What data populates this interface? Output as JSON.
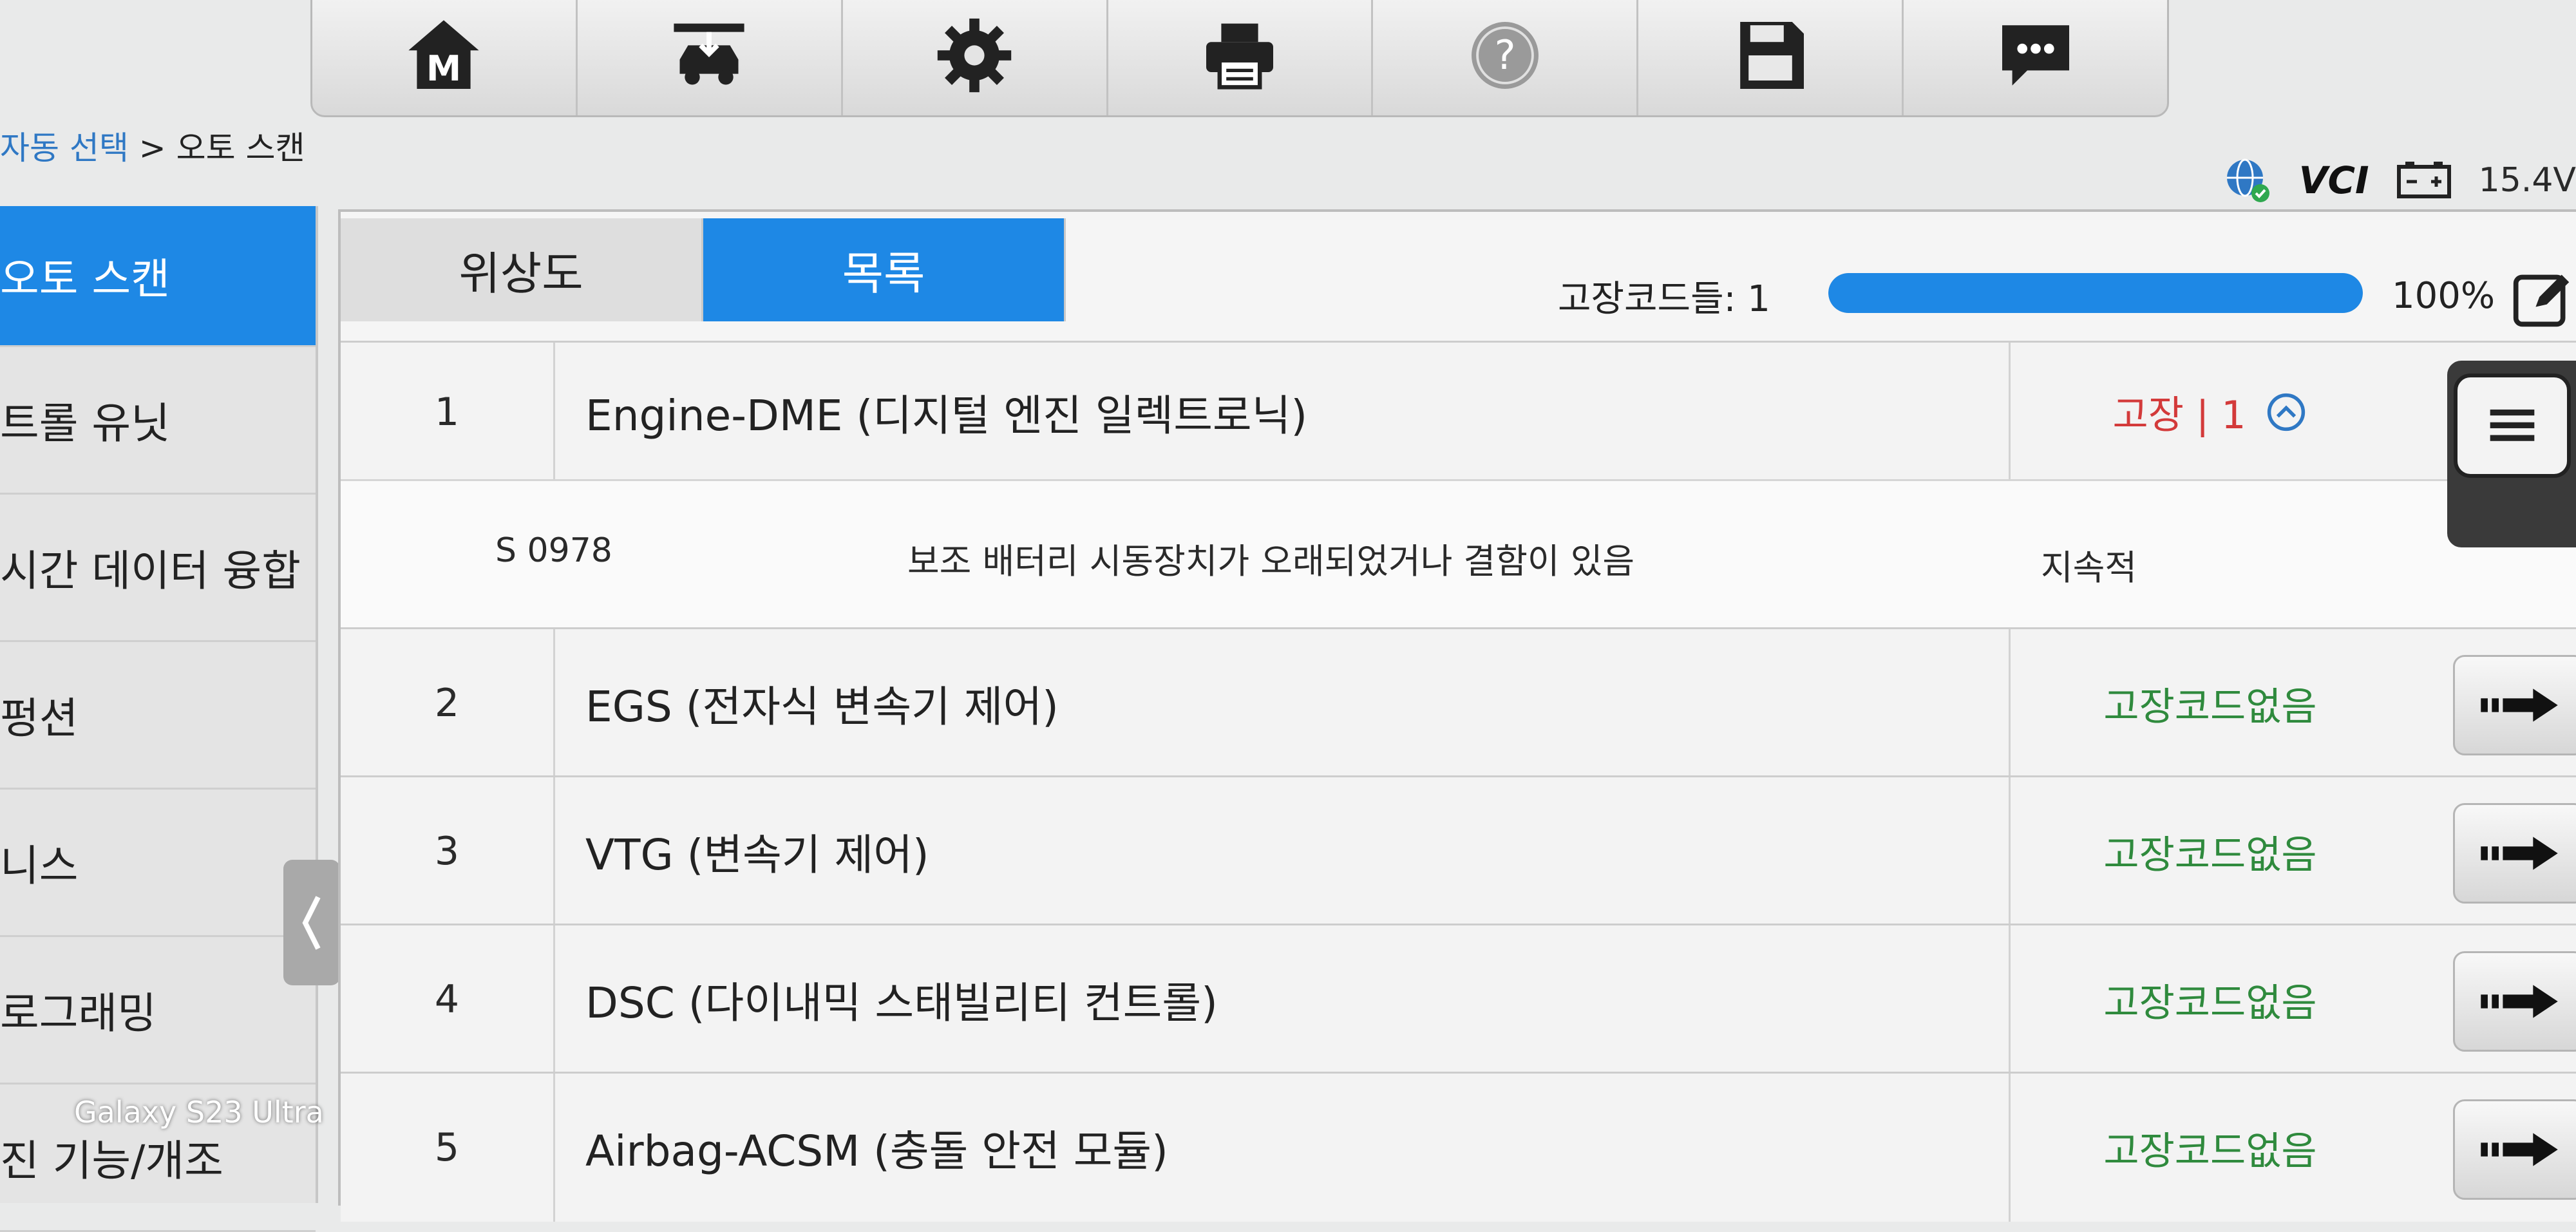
{
  "toolbar": {
    "buttons": [
      {
        "icon": "home-m-icon"
      },
      {
        "icon": "car-lift-icon"
      },
      {
        "icon": "gear-icon"
      },
      {
        "icon": "printer-icon"
      },
      {
        "icon": "help-icon"
      },
      {
        "icon": "save-icon"
      },
      {
        "icon": "chat-icon"
      }
    ]
  },
  "breadcrumb": {
    "link": "자동 선택",
    "sep": " > ",
    "current": "오토 스캔"
  },
  "status": {
    "vci": "VCI",
    "voltage": "15.4V"
  },
  "sidebar": {
    "items": [
      {
        "label": "오토 스캔"
      },
      {
        "label": "트롤 유닛"
      },
      {
        "label": "시간 데이터 융합"
      },
      {
        "label": "펑션"
      },
      {
        "label": "니스"
      },
      {
        "label": "로그래밍"
      },
      {
        "label": "진 기능/개조"
      }
    ]
  },
  "tabs": [
    {
      "label": "위상도"
    },
    {
      "label": "목록"
    }
  ],
  "dtc": {
    "label": "고장코드들: 1",
    "progress": 1.0,
    "progress_text": "100%"
  },
  "rows": [
    {
      "num": "1",
      "name": "Engine-DME (디지털 엔진 일렉트로닉)",
      "status": "고장 | 1"
    },
    {
      "num": "2",
      "name": "EGS (전자식 변속기 제어)",
      "status": "고장코드없음"
    },
    {
      "num": "3",
      "name": "VTG (변속기 제어)",
      "status": "고장코드없음"
    },
    {
      "num": "4",
      "name": "DSC (다이내믹 스태빌리티 컨트롤)",
      "status": "고장코드없음"
    },
    {
      "num": "5",
      "name": "Airbag-ACSM (충돌 안전 모듈)",
      "status": "고장코드없음"
    }
  ],
  "fault_detail": {
    "code": "S 0978",
    "desc": "보조 배터리 시동장치가 오래되었거나 결함이 있음",
    "type": "지속적"
  },
  "watermark": "Galaxy S23 Ultra",
  "colors": {
    "accent": "#1e88e5",
    "fault": "#d33a3a",
    "ok": "#2f8a3d"
  }
}
